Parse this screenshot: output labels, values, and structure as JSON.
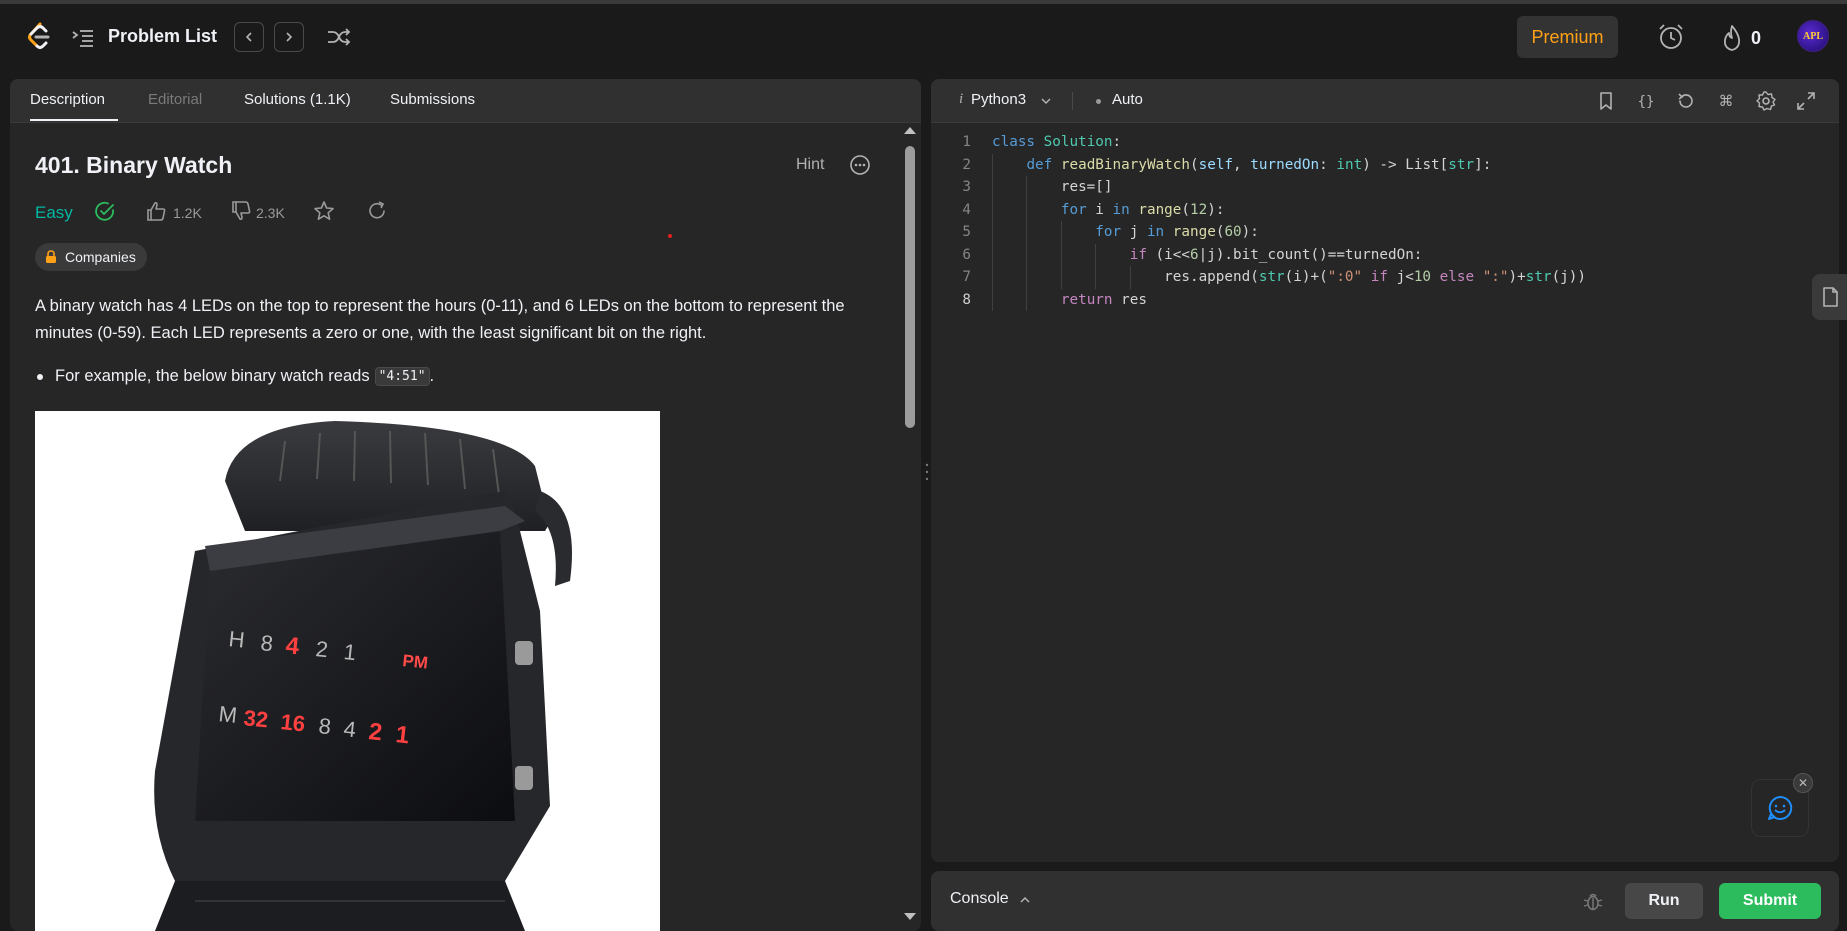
{
  "topbar": {
    "problem_list_label": "Problem List",
    "premium_label": "Premium",
    "streak_count": "0",
    "avatar_text": "APL"
  },
  "left_panel": {
    "tabs": [
      {
        "label": "Description",
        "active": true
      },
      {
        "label": "Editorial",
        "active": false
      },
      {
        "label": "Solutions (1.1K)",
        "active": false
      },
      {
        "label": "Submissions",
        "active": false
      }
    ],
    "title": "401. Binary Watch",
    "hint_label": "Hint",
    "difficulty": "Easy",
    "likes": "1.2K",
    "dislikes": "2.3K",
    "companies_label": "Companies",
    "description": "A binary watch has 4 LEDs on the top to represent the hours (0-11), and 6 LEDs on the bottom to represent the minutes (0-59). Each LED represents a zero or one, with the least significant bit on the right.",
    "example_text": "For example, the below binary watch reads",
    "example_code": "\"4:51\"",
    "example_end": ".",
    "watch_image": {
      "hour_label": "H",
      "hour_leds": [
        "8",
        "4",
        "2",
        "1"
      ],
      "hour_lit": [
        false,
        true,
        false,
        false
      ],
      "pm_label": "PM",
      "minute_label": "M",
      "minute_leds": [
        "32",
        "16",
        "8",
        "4",
        "2",
        "1"
      ],
      "minute_lit": [
        true,
        true,
        false,
        false,
        true,
        true
      ]
    }
  },
  "editor": {
    "language": "Python3",
    "mode": "Auto",
    "active_line": 8,
    "code_lines": [
      "class Solution:",
      "    def readBinaryWatch(self, turnedOn: int) -> List[str]:",
      "        res=[]",
      "        for i in range(12):",
      "            for j in range(60):",
      "                if (i<<6|j).bit_count()==turnedOn:",
      "                    res.append(str(i)+(\":0\" if j<10 else \":\")+str(j))",
      "        return res"
    ]
  },
  "console": {
    "label": "Console",
    "run_label": "Run",
    "submit_label": "Submit"
  },
  "colors": {
    "accent_premium": "#ffa116",
    "easy": "#00b8a3",
    "submit": "#2cbb5d",
    "background": "#1a1a1a",
    "panel": "#262626"
  }
}
